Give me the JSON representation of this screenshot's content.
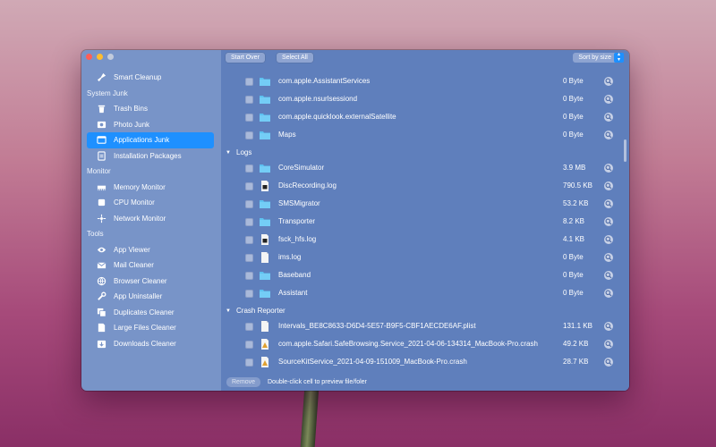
{
  "sidebar": {
    "entries": [
      {
        "kind": "item",
        "label": "Smart Cleanup",
        "icon": "broom-icon"
      },
      {
        "kind": "section",
        "label": "System Junk"
      },
      {
        "kind": "item",
        "label": "Trash Bins",
        "icon": "trash-icon"
      },
      {
        "kind": "item",
        "label": "Photo Junk",
        "icon": "photo-icon"
      },
      {
        "kind": "item",
        "label": "Applications Junk",
        "icon": "app-window-icon",
        "selected": true
      },
      {
        "kind": "item",
        "label": "Installation Packages",
        "icon": "package-icon"
      },
      {
        "kind": "section",
        "label": "Monitor"
      },
      {
        "kind": "item",
        "label": "Memory Monitor",
        "icon": "memory-icon"
      },
      {
        "kind": "item",
        "label": "CPU Monitor",
        "icon": "cpu-icon"
      },
      {
        "kind": "item",
        "label": "Network Monitor",
        "icon": "network-icon"
      },
      {
        "kind": "section",
        "label": "Tools"
      },
      {
        "kind": "item",
        "label": "App Viewer",
        "icon": "eye-icon"
      },
      {
        "kind": "item",
        "label": "Mail Cleaner",
        "icon": "mail-icon"
      },
      {
        "kind": "item",
        "label": "Browser Cleaner",
        "icon": "globe-icon"
      },
      {
        "kind": "item",
        "label": "App Uninstaller",
        "icon": "wrench-icon"
      },
      {
        "kind": "item",
        "label": "Duplicates Cleaner",
        "icon": "duplicate-icon"
      },
      {
        "kind": "item",
        "label": "Large Files Cleaner",
        "icon": "large-file-icon"
      },
      {
        "kind": "item",
        "label": "Downloads Cleaner",
        "icon": "download-icon"
      }
    ]
  },
  "toolbar": {
    "start_over": "Start Over",
    "select_all": "Select All",
    "sort": "Sort by size"
  },
  "list": [
    {
      "kind": "file",
      "name": "com.apple.AssistantServices",
      "size": "0 Byte",
      "icon": "folder"
    },
    {
      "kind": "file",
      "name": "com.apple.nsurlsessiond",
      "size": "0 Byte",
      "icon": "folder"
    },
    {
      "kind": "file",
      "name": "com.apple.quicklook.externalSatellite",
      "size": "0 Byte",
      "icon": "folder"
    },
    {
      "kind": "file",
      "name": "Maps",
      "size": "0 Byte",
      "icon": "folder"
    },
    {
      "kind": "group",
      "name": "Logs"
    },
    {
      "kind": "file",
      "name": "CoreSimulator",
      "size": "3.9 MB",
      "icon": "folder"
    },
    {
      "kind": "file",
      "name": "DiscRecording.log",
      "size": "790.5 KB",
      "icon": "log"
    },
    {
      "kind": "file",
      "name": "SMSMigrator",
      "size": "53.2 KB",
      "icon": "folder"
    },
    {
      "kind": "file",
      "name": "Transporter",
      "size": "8.2 KB",
      "icon": "folder"
    },
    {
      "kind": "file",
      "name": "fsck_hfs.log",
      "size": "4.1 KB",
      "icon": "log"
    },
    {
      "kind": "file",
      "name": "ims.log",
      "size": "0 Byte",
      "icon": "document"
    },
    {
      "kind": "file",
      "name": "Baseband",
      "size": "0 Byte",
      "icon": "folder"
    },
    {
      "kind": "file",
      "name": "Assistant",
      "size": "0 Byte",
      "icon": "folder"
    },
    {
      "kind": "group",
      "name": "Crash Reporter"
    },
    {
      "kind": "file",
      "name": "Intervals_BE8C8633-D6D4-5E57-B9F5-CBF1AECDE6AF.plist",
      "size": "131.1 KB",
      "icon": "document"
    },
    {
      "kind": "file",
      "name": "com.apple.Safari.SafeBrowsing.Service_2021-04-06-134314_MacBook-Pro.crash",
      "size": "49.2 KB",
      "icon": "crash"
    },
    {
      "kind": "file",
      "name": "SourceKitService_2021-04-09-151009_MacBook-Pro.crash",
      "size": "28.7 KB",
      "icon": "crash"
    }
  ],
  "bottom": {
    "remove": "Remove",
    "hint": "Double-click cell to preview file/foler"
  },
  "colors": {
    "sidebar_bg": "#7894c8",
    "main_bg": "#5f7fbc",
    "selection": "#1e90ff"
  }
}
